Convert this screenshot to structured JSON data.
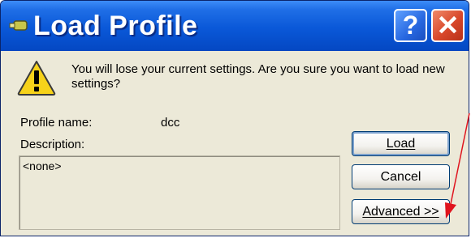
{
  "window": {
    "title": "Load Profile",
    "help_label": "?",
    "close_label": "✕"
  },
  "message": "You will lose your current settings. Are you sure you want to load new settings?",
  "profile": {
    "name_label": "Profile name:",
    "name_value": "dcc",
    "description_label": "Description:",
    "description_value": "<none>"
  },
  "buttons": {
    "load": "Load",
    "cancel": "Cancel",
    "advanced": "Advanced >>"
  },
  "colors": {
    "titlebar": "#0a58d8",
    "annotation_arrow": "#e0141e",
    "warning": "#f6d21a"
  }
}
